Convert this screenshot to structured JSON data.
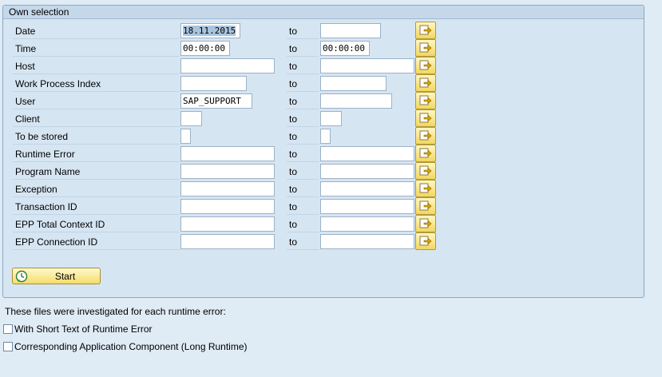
{
  "group": {
    "title": "Own selection"
  },
  "to_label": "to",
  "rows": [
    {
      "label": "Date",
      "from": "18.11.2015",
      "to": ""
    },
    {
      "label": "Time",
      "from": "00:00:00",
      "to": "00:00:00"
    },
    {
      "label": "Host",
      "from": "",
      "to": ""
    },
    {
      "label": "Work Process Index",
      "from": "",
      "to": ""
    },
    {
      "label": "User",
      "from": "SAP_SUPPORT",
      "to": ""
    },
    {
      "label": "Client",
      "from": "",
      "to": ""
    },
    {
      "label": "To be stored",
      "from": "",
      "to": ""
    },
    {
      "label": "Runtime Error",
      "from": "",
      "to": ""
    },
    {
      "label": "Program Name",
      "from": "",
      "to": ""
    },
    {
      "label": "Exception",
      "from": "",
      "to": ""
    },
    {
      "label": "Transaction ID",
      "from": "",
      "to": ""
    },
    {
      "label": "EPP Total Context ID",
      "from": "",
      "to": ""
    },
    {
      "label": "EPP Connection ID",
      "from": "",
      "to": ""
    }
  ],
  "multiple_selection_icon": "arrow-right-icon",
  "start_button": {
    "label": "Start",
    "icon": "clock-execute-icon"
  },
  "info_text": "These files were investigated for each runtime error:",
  "checkboxes": [
    {
      "label": "With Short Text of Runtime Error",
      "checked": false
    },
    {
      "label": "Corresponding Application Component (Long Runtime)",
      "checked": false
    }
  ]
}
